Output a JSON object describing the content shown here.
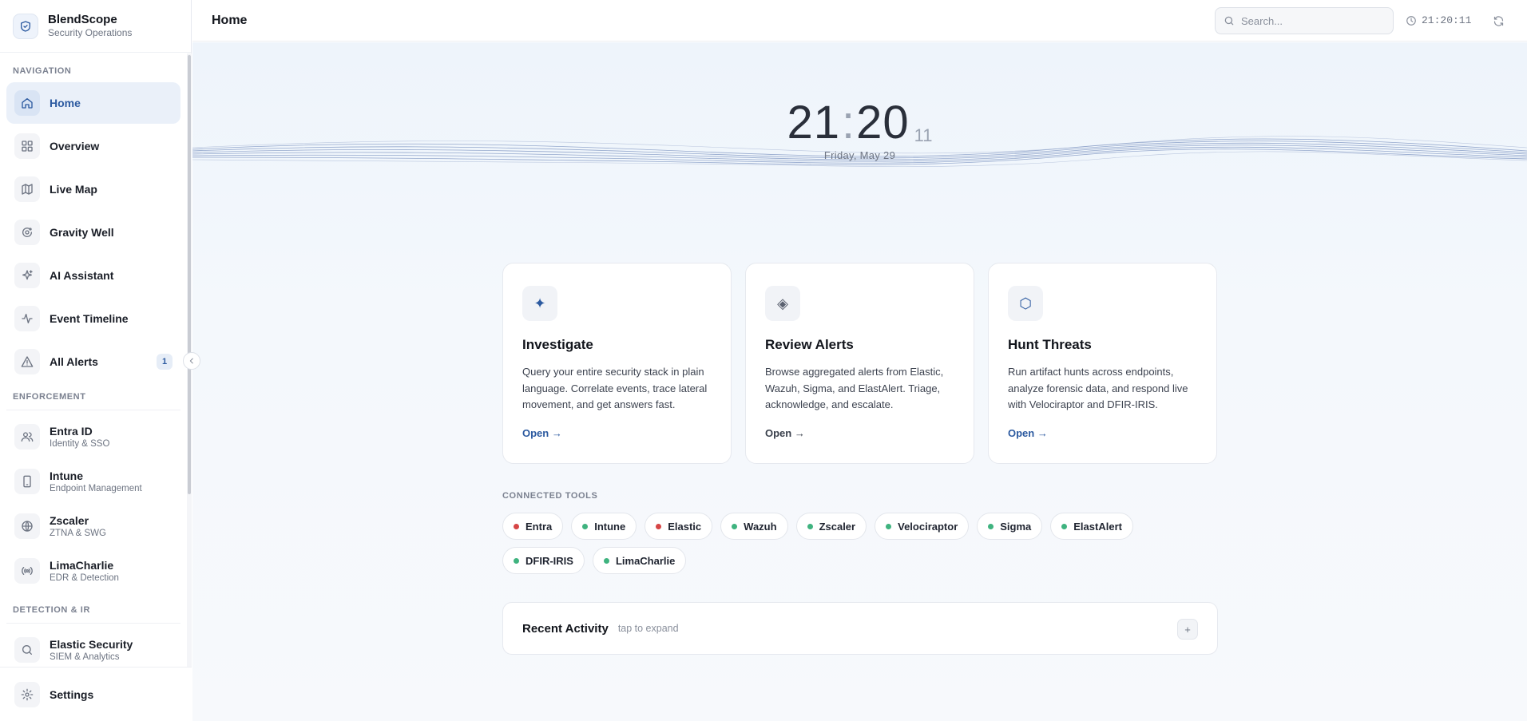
{
  "brand": {
    "name": "BlendScope",
    "subtitle": "Security Operations"
  },
  "sidebar": {
    "sections": {
      "navigation": "NAVIGATION",
      "enforcement": "ENFORCEMENT",
      "detection": "DETECTION & IR"
    },
    "nav": [
      {
        "label": "Home",
        "icon": "home-icon"
      },
      {
        "label": "Overview",
        "icon": "grid-icon"
      },
      {
        "label": "Live Map",
        "icon": "map-icon"
      },
      {
        "label": "Gravity Well",
        "icon": "orbit-icon"
      },
      {
        "label": "AI Assistant",
        "icon": "sparkle-icon"
      },
      {
        "label": "Event Timeline",
        "icon": "activity-icon"
      },
      {
        "label": "All Alerts",
        "icon": "alert-triangle-icon",
        "badge": "1"
      }
    ],
    "enforcement": [
      {
        "label": "Entra ID",
        "sub": "Identity & SSO",
        "icon": "users-icon"
      },
      {
        "label": "Intune",
        "sub": "Endpoint Management",
        "icon": "phone-icon"
      },
      {
        "label": "Zscaler",
        "sub": "ZTNA & SWG",
        "icon": "globe-icon"
      },
      {
        "label": "LimaCharlie",
        "sub": "EDR & Detection",
        "icon": "radio-icon"
      }
    ],
    "detection": [
      {
        "label": "Elastic Security",
        "sub": "SIEM & Analytics",
        "icon": "search-icon"
      }
    ],
    "settings": {
      "label": "Settings",
      "icon": "gear-icon"
    }
  },
  "header": {
    "title": "Home",
    "search_placeholder": "Search...",
    "clock": "21:20:11"
  },
  "clock": {
    "hours": "21",
    "minutes": "20",
    "seconds": "11",
    "date": "Friday, May 29"
  },
  "cards": [
    {
      "title": "Investigate",
      "desc": "Query your entire security stack in plain language. Correlate events, trace lateral movement, and get answers fast.",
      "link": "Open →",
      "icon": "sparkle-icon",
      "glyph": "✦"
    },
    {
      "title": "Review Alerts",
      "desc": "Browse aggregated alerts from Elastic, Wazuh, Sigma, and ElastAlert. Triage, acknowledge, and escalate.",
      "link": "Open →",
      "icon": "diamond-icon",
      "glyph": "◈"
    },
    {
      "title": "Hunt Threats",
      "desc": "Run artifact hunts across endpoints, analyze forensic data, and respond live with Velociraptor and DFIR-IRIS.",
      "link": "Open →",
      "icon": "hexagon-icon",
      "glyph": "⬡"
    }
  ],
  "connected_tools": {
    "label": "CONNECTED TOOLS",
    "tools": [
      {
        "name": "Entra",
        "status_color": "#d64545"
      },
      {
        "name": "Intune",
        "status_color": "#3fb37f"
      },
      {
        "name": "Elastic",
        "status_color": "#d64545"
      },
      {
        "name": "Wazuh",
        "status_color": "#3fb37f"
      },
      {
        "name": "Zscaler",
        "status_color": "#3fb37f"
      },
      {
        "name": "Velociraptor",
        "status_color": "#3fb37f"
      },
      {
        "name": "Sigma",
        "status_color": "#3fb37f"
      },
      {
        "name": "ElastAlert",
        "status_color": "#3fb37f"
      },
      {
        "name": "DFIR-IRIS",
        "status_color": "#3fb37f"
      },
      {
        "name": "LimaCharlie",
        "status_color": "#3fb37f"
      }
    ]
  },
  "activity": {
    "title": "Recent Activity",
    "hint": "tap to expand",
    "expand": "+"
  },
  "colors": {
    "accent": "#2c5aa0",
    "ok": "#3fb37f",
    "error": "#d64545"
  }
}
